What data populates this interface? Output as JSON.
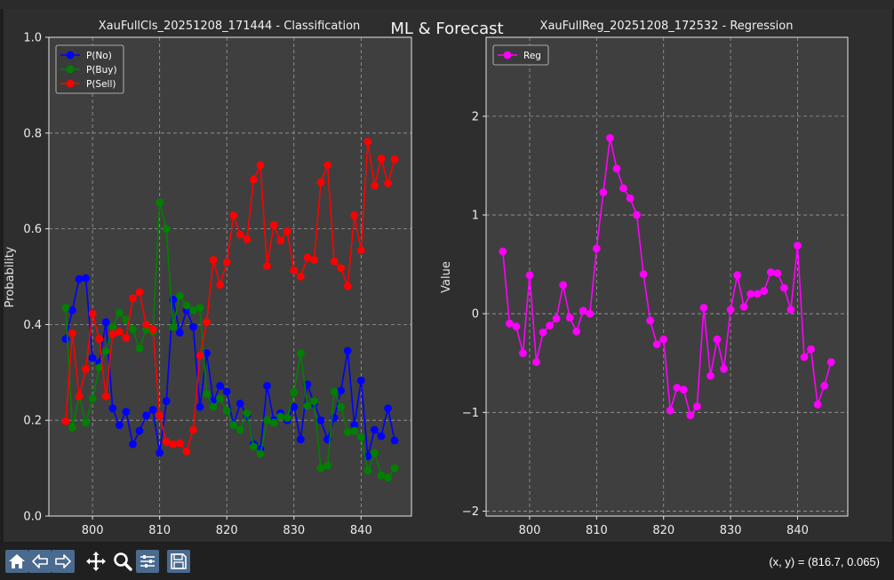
{
  "figure": {
    "suptitle": "ML & Forecast"
  },
  "toolbar": {
    "coords_text": "(x, y) = (816.7, 0.065)",
    "buttons": [
      "home-icon",
      "back-icon",
      "forward-icon",
      "pan-icon",
      "zoom-icon",
      "configure-icon",
      "save-icon"
    ]
  },
  "colors": {
    "figure_bg": "#2e2e2e",
    "axes_bg": "#3f3f3f",
    "p_no": "#0000ff",
    "p_buy": "#008000",
    "p_sell": "#ff0000",
    "reg": "#ff00ff"
  },
  "chart_data": [
    {
      "type": "line",
      "title": "XauFullCls_20251208_171444 - Classification",
      "xlabel": "",
      "ylabel": "Probability",
      "xlim": [
        793.5,
        847.5
      ],
      "ylim": [
        0.0,
        1.0
      ],
      "xticks": [
        800,
        810,
        820,
        830,
        840
      ],
      "yticks": [
        0.0,
        0.2,
        0.4,
        0.6,
        0.8,
        1.0
      ],
      "ytick_labels": [
        "0.0",
        "0.2",
        "0.4",
        "0.6",
        "0.8",
        "1.0"
      ],
      "xtick_labels": [
        "800",
        "810",
        "820",
        "830",
        "840"
      ],
      "grid": true,
      "legend": "top-left",
      "x": [
        796,
        797,
        798,
        799,
        800,
        801,
        802,
        803,
        804,
        805,
        806,
        807,
        808,
        809,
        810,
        811,
        812,
        813,
        814,
        815,
        816,
        817,
        818,
        819,
        820,
        821,
        822,
        823,
        824,
        825,
        826,
        827,
        828,
        829,
        830,
        831,
        832,
        833,
        834,
        835,
        836,
        837,
        838,
        839,
        840,
        841,
        842,
        843,
        844,
        845
      ],
      "series": [
        {
          "name": "P(No)",
          "color": "#0000ff",
          "values": [
            0.37,
            0.43,
            0.495,
            0.497,
            0.33,
            0.32,
            0.405,
            0.225,
            0.19,
            0.218,
            0.15,
            0.178,
            0.21,
            0.222,
            0.132,
            0.24,
            0.452,
            0.383,
            0.43,
            0.395,
            0.228,
            0.34,
            0.24,
            0.272,
            0.26,
            0.19,
            0.235,
            0.21,
            0.15,
            0.14,
            0.272,
            0.2,
            0.215,
            0.2,
            0.228,
            0.16,
            0.275,
            0.235,
            0.2,
            0.16,
            0.205,
            0.262,
            0.345,
            0.19,
            0.283,
            0.125,
            0.18,
            0.167,
            0.225,
            0.158
          ]
        },
        {
          "name": "P(Buy)",
          "color": "#008000",
          "values": [
            0.435,
            0.185,
            0.25,
            0.195,
            0.245,
            0.31,
            0.345,
            0.395,
            0.425,
            0.41,
            0.39,
            0.35,
            0.39,
            0.385,
            0.655,
            0.6,
            0.395,
            0.46,
            0.44,
            0.43,
            0.435,
            0.255,
            0.228,
            0.245,
            0.22,
            0.19,
            0.18,
            0.215,
            0.145,
            0.13,
            0.2,
            0.195,
            0.208,
            0.205,
            0.258,
            0.34,
            0.23,
            0.24,
            0.1,
            0.105,
            0.26,
            0.228,
            0.175,
            0.178,
            0.165,
            0.095,
            0.132,
            0.085,
            0.08,
            0.1
          ]
        },
        {
          "name": "P(Sell)",
          "color": "#ff0000",
          "values": [
            0.198,
            0.382,
            0.25,
            0.307,
            0.423,
            0.37,
            0.25,
            0.38,
            0.385,
            0.372,
            0.455,
            0.468,
            0.4,
            0.39,
            0.21,
            0.155,
            0.15,
            0.152,
            0.135,
            0.18,
            0.335,
            0.405,
            0.535,
            0.483,
            0.53,
            0.628,
            0.588,
            0.578,
            0.703,
            0.733,
            0.522,
            0.608,
            0.575,
            0.595,
            0.513,
            0.5,
            0.54,
            0.535,
            0.697,
            0.733,
            0.532,
            0.518,
            0.48,
            0.628,
            0.555,
            0.782,
            0.69,
            0.747,
            0.695,
            0.745
          ]
        }
      ]
    },
    {
      "type": "line",
      "title": "XauFullReg_20251208_172532 - Regression",
      "xlabel": "",
      "ylabel": "Value",
      "xlim": [
        793.5,
        847.5
      ],
      "ylim": [
        -2.05,
        2.8
      ],
      "xticks": [
        800,
        810,
        820,
        830,
        840
      ],
      "yticks": [
        -2,
        -1,
        0,
        1,
        2
      ],
      "ytick_labels": [
        "−2",
        "−1",
        "0",
        "1",
        "2"
      ],
      "xtick_labels": [
        "800",
        "810",
        "820",
        "830",
        "840"
      ],
      "grid": true,
      "legend": "top-left",
      "x": [
        796,
        797,
        798,
        799,
        800,
        801,
        802,
        803,
        804,
        805,
        806,
        807,
        808,
        809,
        810,
        811,
        812,
        813,
        814,
        815,
        816,
        817,
        818,
        819,
        820,
        821,
        822,
        823,
        824,
        825,
        826,
        827,
        828,
        829,
        830,
        831,
        832,
        833,
        834,
        835,
        836,
        837,
        838,
        839,
        840,
        841,
        842,
        843,
        844,
        845
      ],
      "series": [
        {
          "name": "Reg",
          "color": "#ff00ff",
          "values": [
            0.63,
            -0.1,
            -0.13,
            -0.4,
            0.39,
            -0.49,
            -0.19,
            -0.12,
            -0.05,
            0.29,
            -0.04,
            -0.18,
            0.03,
            0.0,
            0.66,
            1.23,
            1.78,
            1.47,
            1.27,
            1.17,
            1.0,
            0.4,
            -0.07,
            -0.31,
            -0.26,
            -0.98,
            -0.75,
            -0.77,
            -1.03,
            -0.94,
            0.06,
            -0.63,
            -0.26,
            -0.56,
            0.04,
            0.39,
            0.07,
            0.2,
            0.2,
            0.23,
            0.42,
            0.41,
            0.26,
            0.04,
            0.69,
            -0.44,
            -0.36,
            -0.92,
            -0.73,
            -0.49
          ]
        }
      ]
    }
  ]
}
